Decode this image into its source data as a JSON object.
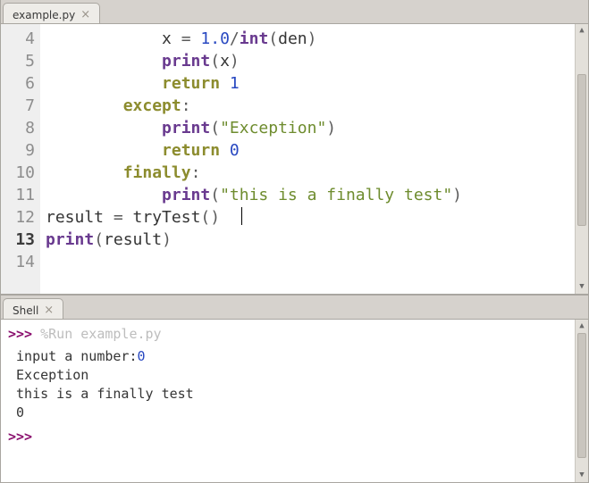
{
  "editor": {
    "tab_label": "example.py",
    "line_start": 4,
    "current_line": 13,
    "lines": [
      {
        "n": 4,
        "segs": [
          [
            "ws",
            "            "
          ],
          [
            "name",
            "x"
          ],
          [
            "op",
            " = "
          ],
          [
            "num",
            "1.0"
          ],
          [
            "op",
            "/"
          ],
          [
            "kw2",
            "int"
          ],
          [
            "op",
            "("
          ],
          [
            "name",
            "den"
          ],
          [
            "op",
            ")"
          ]
        ]
      },
      {
        "n": 5,
        "segs": [
          [
            "ws",
            "            "
          ],
          [
            "kw2",
            "print"
          ],
          [
            "op",
            "("
          ],
          [
            "name",
            "x"
          ],
          [
            "op",
            ")"
          ]
        ]
      },
      {
        "n": 6,
        "segs": [
          [
            "ws",
            "            "
          ],
          [
            "kw",
            "return"
          ],
          [
            "ws",
            " "
          ],
          [
            "num",
            "1"
          ]
        ]
      },
      {
        "n": 7,
        "segs": [
          [
            "ws",
            "        "
          ],
          [
            "kw",
            "except"
          ],
          [
            "op",
            ":"
          ]
        ]
      },
      {
        "n": 8,
        "segs": [
          [
            "ws",
            "            "
          ],
          [
            "kw2",
            "print"
          ],
          [
            "op",
            "("
          ],
          [
            "str",
            "\"Exception\""
          ],
          [
            "op",
            ")"
          ]
        ]
      },
      {
        "n": 9,
        "segs": [
          [
            "ws",
            "            "
          ],
          [
            "kw",
            "return"
          ],
          [
            "ws",
            " "
          ],
          [
            "num",
            "0"
          ]
        ]
      },
      {
        "n": 10,
        "segs": [
          [
            "ws",
            "        "
          ],
          [
            "kw",
            "finally"
          ],
          [
            "op",
            ":"
          ]
        ]
      },
      {
        "n": 11,
        "segs": [
          [
            "ws",
            "            "
          ],
          [
            "kw2",
            "print"
          ],
          [
            "op",
            "("
          ],
          [
            "str",
            "\"this is a finally test\""
          ],
          [
            "op",
            ")"
          ]
        ]
      },
      {
        "n": 12,
        "segs": []
      },
      {
        "n": 13,
        "segs": [
          [
            "name",
            "result"
          ],
          [
            "op",
            " = "
          ],
          [
            "name",
            "tryTest"
          ],
          [
            "op",
            "()  "
          ],
          [
            "caret",
            ""
          ]
        ]
      },
      {
        "n": 14,
        "segs": [
          [
            "kw2",
            "print"
          ],
          [
            "op",
            "("
          ],
          [
            "name",
            "result"
          ],
          [
            "op",
            ")"
          ]
        ]
      }
    ]
  },
  "shell": {
    "tab_label": "Shell",
    "prompt": ">>>",
    "run_cmd": "%Run example.py",
    "output": [
      {
        "pre": " ",
        "t": "input a number:",
        "num": "0"
      },
      {
        "pre": " ",
        "t": "Exception"
      },
      {
        "pre": " ",
        "t": "this is a finally test"
      },
      {
        "pre": " ",
        "t": "0"
      }
    ]
  }
}
